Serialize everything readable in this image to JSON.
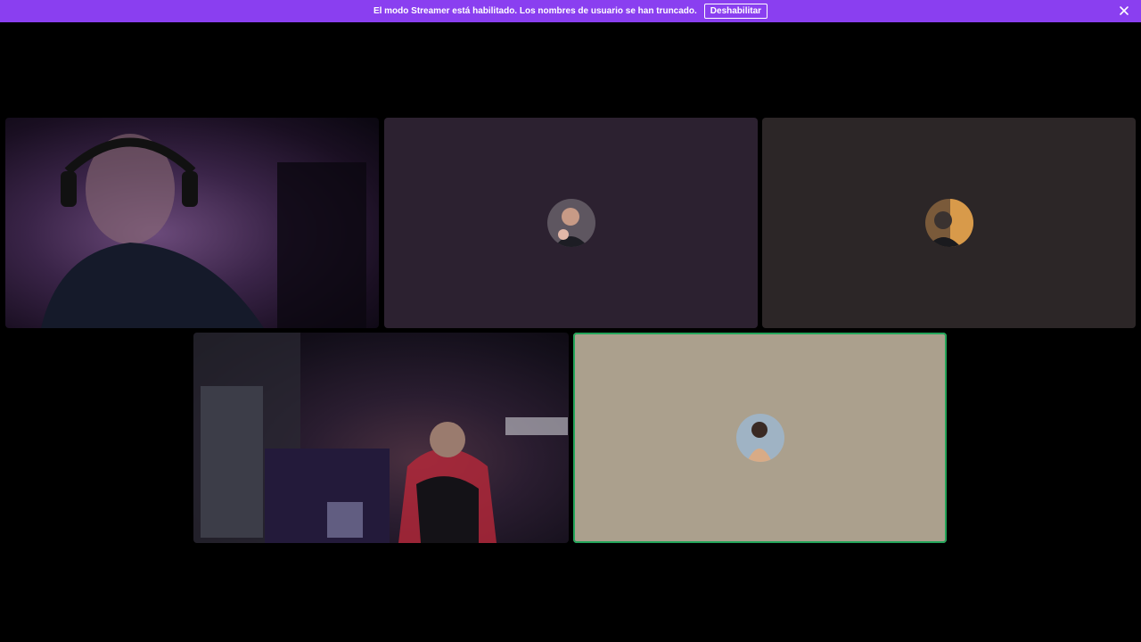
{
  "banner": {
    "message": "El modo Streamer está habilitado. Los nombres de usuario se han truncado.",
    "disable_label": "Deshabilitar",
    "close_icon": "close-icon",
    "color": "#8a3ff0"
  },
  "tiles": [
    {
      "kind": "video",
      "background": "#2a1a34"
    },
    {
      "kind": "avatar",
      "background": "#2c2130",
      "icon": "user-avatar-icon"
    },
    {
      "kind": "avatar",
      "background": "#2c2627",
      "icon": "user-avatar-icon"
    },
    {
      "kind": "video",
      "background": "#1d1622"
    },
    {
      "kind": "avatar",
      "background": "#aba08d",
      "icon": "user-avatar-icon",
      "speaking": true,
      "speaking_color": "#23a55a"
    }
  ]
}
